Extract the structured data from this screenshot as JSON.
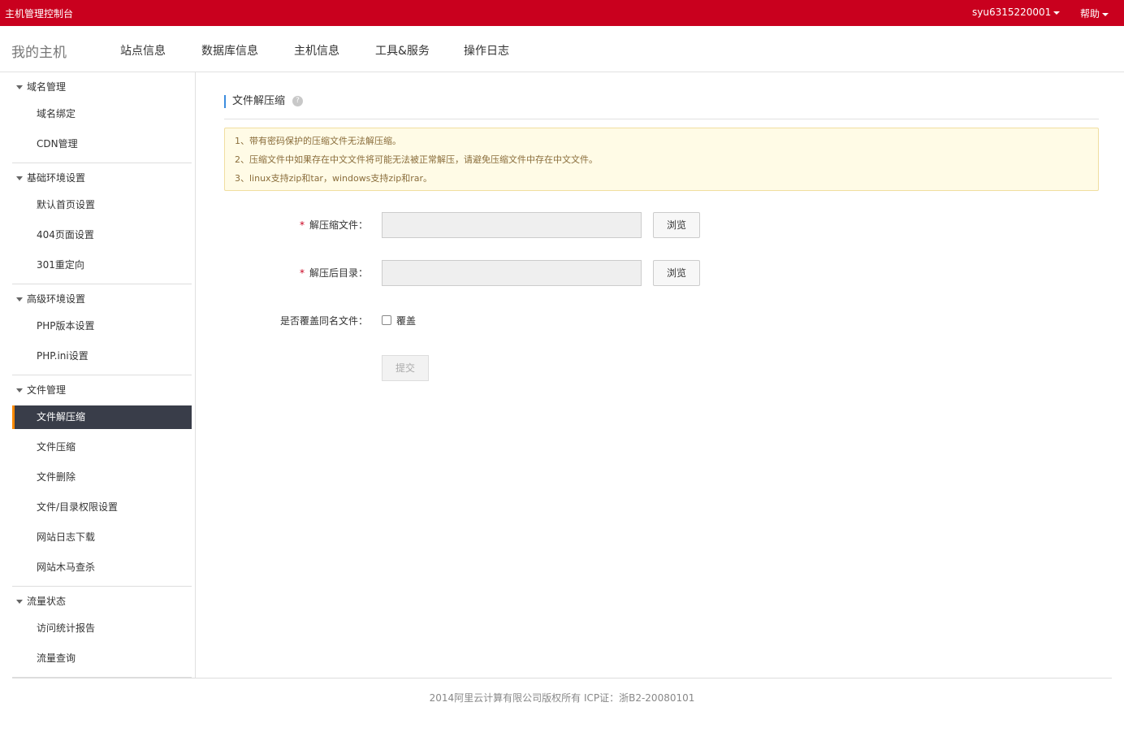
{
  "topbar": {
    "title": "主机管理控制台",
    "user": "syu6315220001",
    "help": "帮助"
  },
  "header": {
    "brand": "我的主机",
    "nav": [
      "站点信息",
      "数据库信息",
      "主机信息",
      "工具&服务",
      "操作日志"
    ]
  },
  "sidebar": {
    "groups": [
      {
        "label": "域名管理",
        "items": [
          "域名绑定",
          "CDN管理"
        ]
      },
      {
        "label": "基础环境设置",
        "items": [
          "默认首页设置",
          "404页面设置",
          "301重定向"
        ]
      },
      {
        "label": "高级环境设置",
        "items": [
          "PHP版本设置",
          "PHP.ini设置"
        ]
      },
      {
        "label": "文件管理",
        "items": [
          "文件解压缩",
          "文件压缩",
          "文件删除",
          "文件/目录权限设置",
          "网站日志下载",
          "网站木马查杀"
        ]
      },
      {
        "label": "流量状态",
        "items": [
          "访问统计报告",
          "流量查询"
        ]
      }
    ],
    "active_item": "文件解压缩"
  },
  "main": {
    "title": "文件解压缩",
    "help_icon": "?",
    "notices": [
      "1、带有密码保护的压缩文件无法解压缩。",
      "2、压缩文件中如果存在中文文件将可能无法被正常解压，请避免压缩文件中存在中文文件。",
      "3、linux支持zip和tar，windows支持zip和rar。"
    ],
    "form": {
      "archive_label": "解压缩文件：",
      "archive_value": "",
      "target_label": "解压后目录：",
      "target_value": "",
      "browse": "浏览",
      "overwrite_label": "是否覆盖同名文件：",
      "overwrite_option": "覆盖",
      "overwrite_checked": false,
      "required_mark": "*",
      "submit": "提交"
    }
  },
  "footer": {
    "text": "2014阿里云计算有限公司版权所有 ICP证：浙B2-20080101"
  },
  "colors": {
    "topbar": "#c9001e",
    "active_bg": "#393d49",
    "active_accent": "#ff8a00",
    "notice_bg": "#fffbe6"
  }
}
